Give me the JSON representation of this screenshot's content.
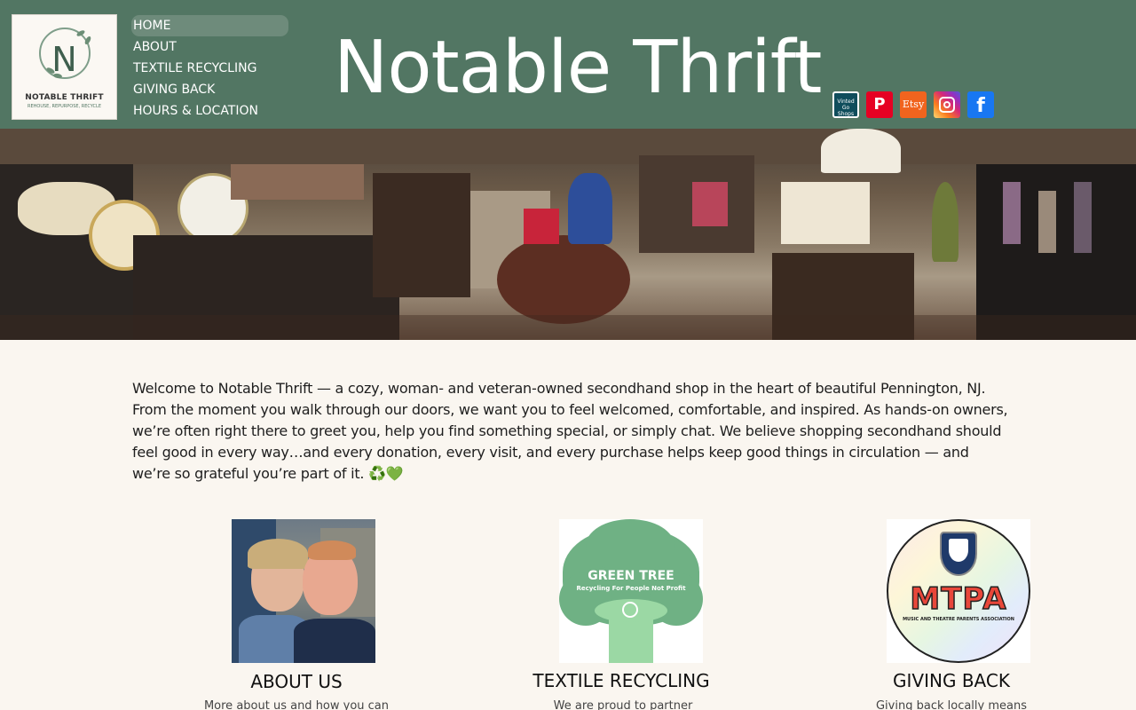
{
  "site": {
    "title": "Notable Thrift",
    "logo_letter": "N",
    "logo_name": "NOTABLE THRIFT",
    "logo_tagline": "REHOUSE, REPURPOSE, RECYCLE"
  },
  "nav": {
    "items": [
      {
        "label": "HOME",
        "active": true
      },
      {
        "label": "ABOUT",
        "active": false
      },
      {
        "label": "TEXTILE RECYCLING",
        "active": false
      },
      {
        "label": "GIVING BACK",
        "active": false
      },
      {
        "label": "HOURS & LOCATION",
        "active": false
      }
    ]
  },
  "social": {
    "vinted_label": "Vinted Go Shops",
    "pinterest_label": "P",
    "etsy_label": "Etsy",
    "facebook_label": "f"
  },
  "intro": {
    "text": "Welcome to Notable Thrift — a cozy, woman- and veteran-owned secondhand shop in the heart of beautiful Pennington, NJ. From the moment you walk through our doors, we want you to feel welcomed, comfortable, and inspired. As hands-on owners, we’re often right there to greet you, help you find something special, or simply chat. We believe shopping secondhand should feel good in every way…and every donation, every visit, and every purchase helps keep good things in circulation — and we’re so grateful you’re part of it. ♻️💚"
  },
  "cards": {
    "about": {
      "title": "ABOUT US",
      "subtitle": "More about us and how you can"
    },
    "textile": {
      "title": "TEXTILE RECYCLING",
      "subtitle": "We are proud to partner",
      "logo_title": "GREEN TREE",
      "logo_sub": "Recycling For People Not Profit"
    },
    "giving": {
      "title": "GIVING BACK",
      "subtitle": "Giving back locally means",
      "logo_title": "MTPA",
      "logo_sub": "MUSIC AND THEATRE PARENTS ASSOCIATION"
    }
  },
  "colors": {
    "header_bg": "#527663",
    "page_bg": "#faf6f0",
    "nav_active_bg": "#6e8b7b"
  }
}
